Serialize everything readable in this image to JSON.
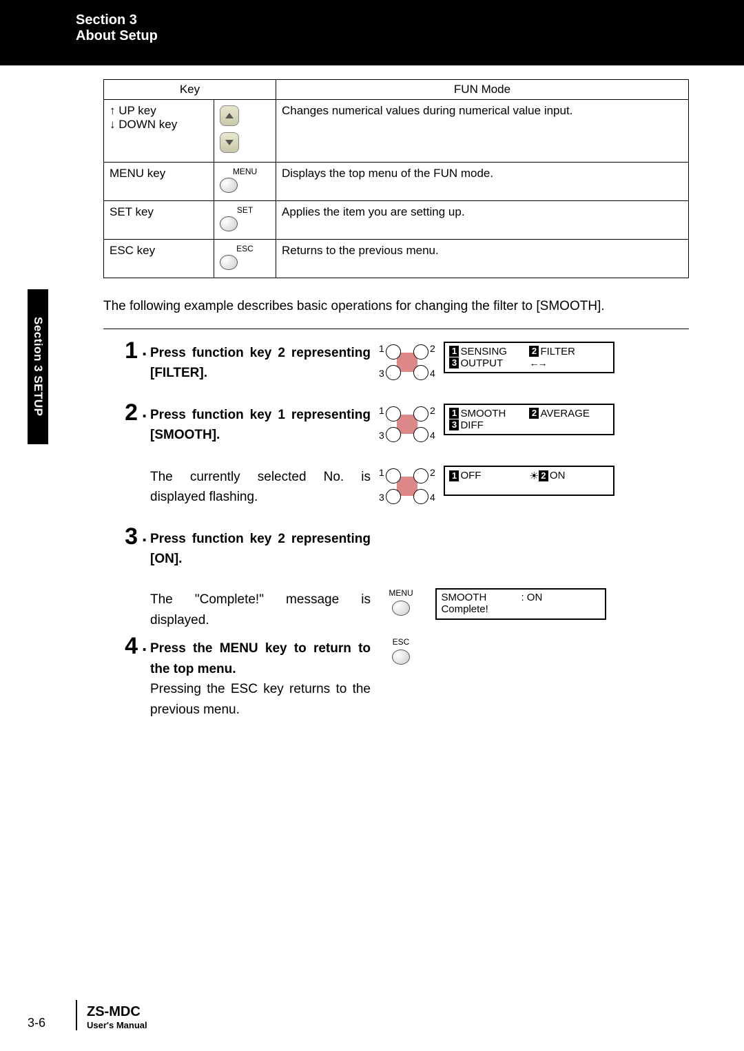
{
  "header": {
    "section_line": "Section 3",
    "title_line": "About Setup"
  },
  "side_tab": "Section 3  SETUP",
  "table": {
    "head_key": "Key",
    "head_mode": "FUN Mode",
    "rows": [
      {
        "name_line1": "↑ UP key",
        "name_line2": "↓ DOWN key",
        "icon_label_top": "",
        "icon_label_bot": "",
        "desc": "Changes numerical values during numerical value input."
      },
      {
        "name_line1": "MENU key",
        "icon_label_top": "MENU",
        "desc": "Displays the top menu of the FUN mode."
      },
      {
        "name_line1": "SET key",
        "icon_label_top": "SET",
        "desc": "Applies the item you are setting up."
      },
      {
        "name_line1": "ESC key",
        "icon_label_top": "ESC",
        "desc": "Returns to the previous menu."
      }
    ]
  },
  "intro": "The following example describes basic operations for changing the filter to [SMOOTH].",
  "steps": {
    "s1": {
      "num": "1",
      "text": "Press function key 2 representing [FILTER].",
      "lcd": {
        "c1": "SENSING",
        "c2": "FILTER",
        "c3": "OUTPUT",
        "arrows": "←→"
      }
    },
    "s2": {
      "num": "2",
      "text": "Press function key 1 representing [SMOOTH].",
      "lcd": {
        "c1": "SMOOTH",
        "c2": "AVERAGE",
        "c3": "DIFF"
      }
    },
    "s2b": {
      "text": "The currently selected No. is displayed flashing.",
      "lcd": {
        "c1": "OFF",
        "c2": "ON"
      }
    },
    "s3": {
      "num": "3",
      "text": "Press function key 2 representing [ON]."
    },
    "s4pre": {
      "text": "The \"Complete!\" message is displayed."
    },
    "s4": {
      "num": "4",
      "text_bold": "Press the MENU key to return to the top menu.",
      "text_plain": "Pressing the ESC key returns to the previous menu.",
      "menu_label": "MENU",
      "esc_label": "ESC",
      "lcd": {
        "left": "SMOOTH",
        "right": ": ON",
        "line2": "Complete!"
      }
    }
  },
  "dpad_labels": {
    "n1": "1",
    "n2": "2",
    "n3": "3",
    "n4": "4"
  },
  "inv_labels": {
    "i1": "1",
    "i2": "2",
    "i3": "3"
  },
  "footer": {
    "page": "3-6",
    "product": "ZS-MDC",
    "manual": "User's Manual"
  }
}
